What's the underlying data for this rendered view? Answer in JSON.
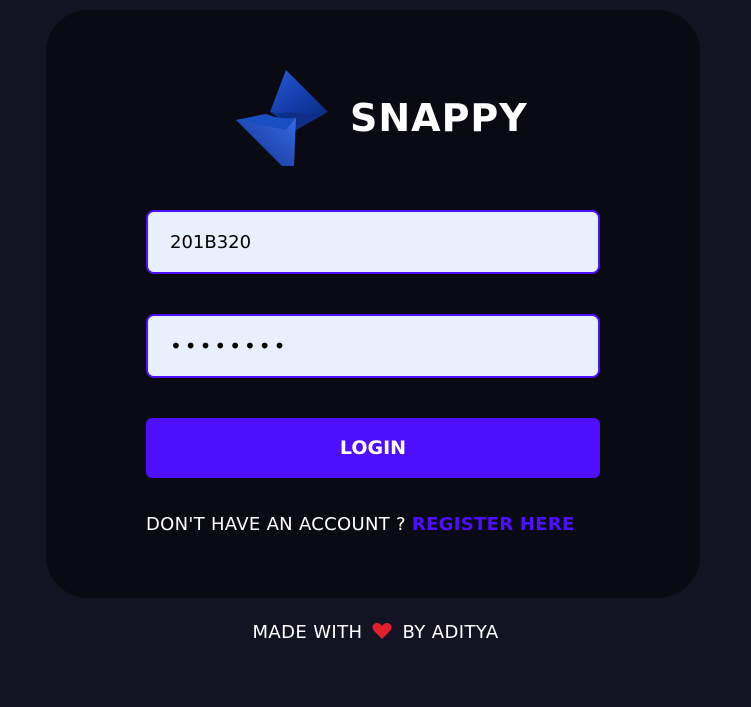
{
  "brand": {
    "name": "SNAPPY",
    "logo_icon": "snappy-logo-icon"
  },
  "login_form": {
    "username_value": "201B320",
    "password_value": "••••••••",
    "login_label": "LOGIN",
    "account_prompt": "DON'T HAVE AN ACCOUNT ?",
    "register_label": "REGISTER HERE"
  },
  "footer": {
    "made_with": "MADE WITH",
    "heart_icon": "heart-icon",
    "by": "BY ADITYA"
  },
  "colors": {
    "page_background": "#131324",
    "card_background": "#0a0a13",
    "accent": "#4e0eff",
    "input_background": "#e8f0fe",
    "text": "#ffffff",
    "heart": "#e0202c"
  }
}
